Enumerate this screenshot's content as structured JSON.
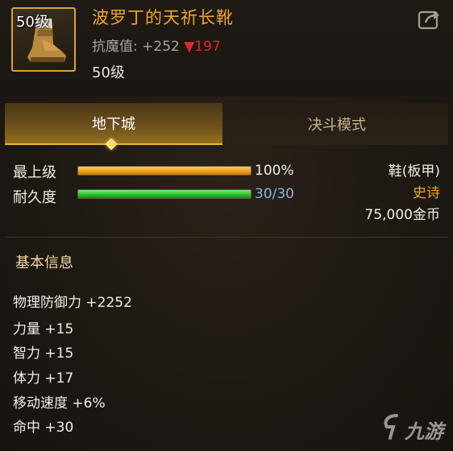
{
  "item": {
    "level_badge": "50级",
    "name": "波罗丁的天祈长靴",
    "resist_label": "抗魔值: +252",
    "resist_delta": "▼197",
    "required_level": "50级"
  },
  "tabs": [
    {
      "label": "地下城",
      "active": true
    },
    {
      "label": "决斗模式",
      "active": false
    }
  ],
  "bars": {
    "top_level": {
      "label": "最上级",
      "value_text": "100%",
      "fraction": 1.0
    },
    "durability": {
      "label": "耐久度",
      "value_text": "30/30",
      "fraction": 1.0
    }
  },
  "meta": {
    "slot_type": "鞋(板甲)",
    "rarity": "史诗",
    "price": "75,000金币"
  },
  "section": {
    "title": "基本信息"
  },
  "stats": [
    "物理防御力 +2252",
    "力量 +15",
    "智力 +15",
    "体力 +17",
    "移动速度 +6%",
    "命中 +30"
  ],
  "watermark": {
    "text": "九游"
  },
  "colors": {
    "name_gold": "#f0a52c",
    "resist_down_red": "#e02a2a",
    "bar_orange": "#f0a21a",
    "bar_green": "#2fbf2c",
    "durability_value_blue": "#8fb4e0"
  },
  "icons": {
    "share": "share-export-icon",
    "item": "boots-icon",
    "tab_marker": "diamond-icon",
    "watermark": "jiuyou-logo"
  }
}
